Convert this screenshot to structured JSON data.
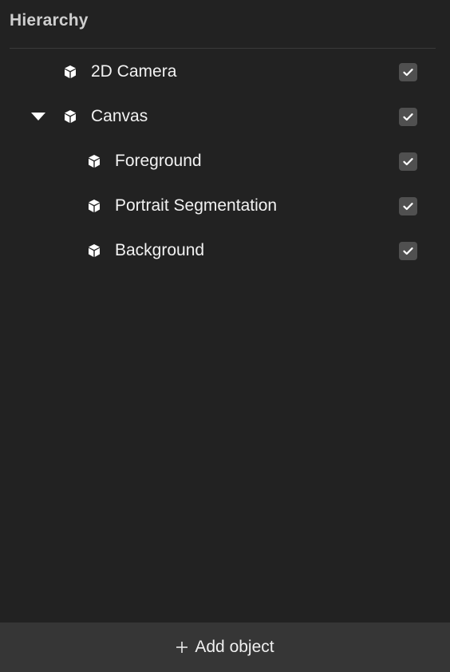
{
  "panel": {
    "title": "Hierarchy"
  },
  "tree": {
    "items": [
      {
        "label": "2D Camera",
        "level": 0,
        "expandable": false,
        "checked": true,
        "icon": "cube-icon"
      },
      {
        "label": "Canvas",
        "level": 0,
        "expandable": true,
        "expanded": true,
        "checked": true,
        "icon": "cube-icon"
      },
      {
        "label": "Foreground",
        "level": 1,
        "expandable": false,
        "checked": true,
        "icon": "cube-icon"
      },
      {
        "label": "Portrait Segmentation",
        "level": 1,
        "expandable": false,
        "checked": true,
        "icon": "cube-icon"
      },
      {
        "label": "Background",
        "level": 1,
        "expandable": false,
        "checked": true,
        "icon": "cube-icon"
      }
    ]
  },
  "footer": {
    "add_label": "Add object",
    "add_icon": "plus-icon"
  },
  "colors": {
    "background": "#222222",
    "footer_background": "#363636",
    "checkbox": "#505050",
    "title": "#cfcfcf",
    "text": "#f2f2f2"
  }
}
